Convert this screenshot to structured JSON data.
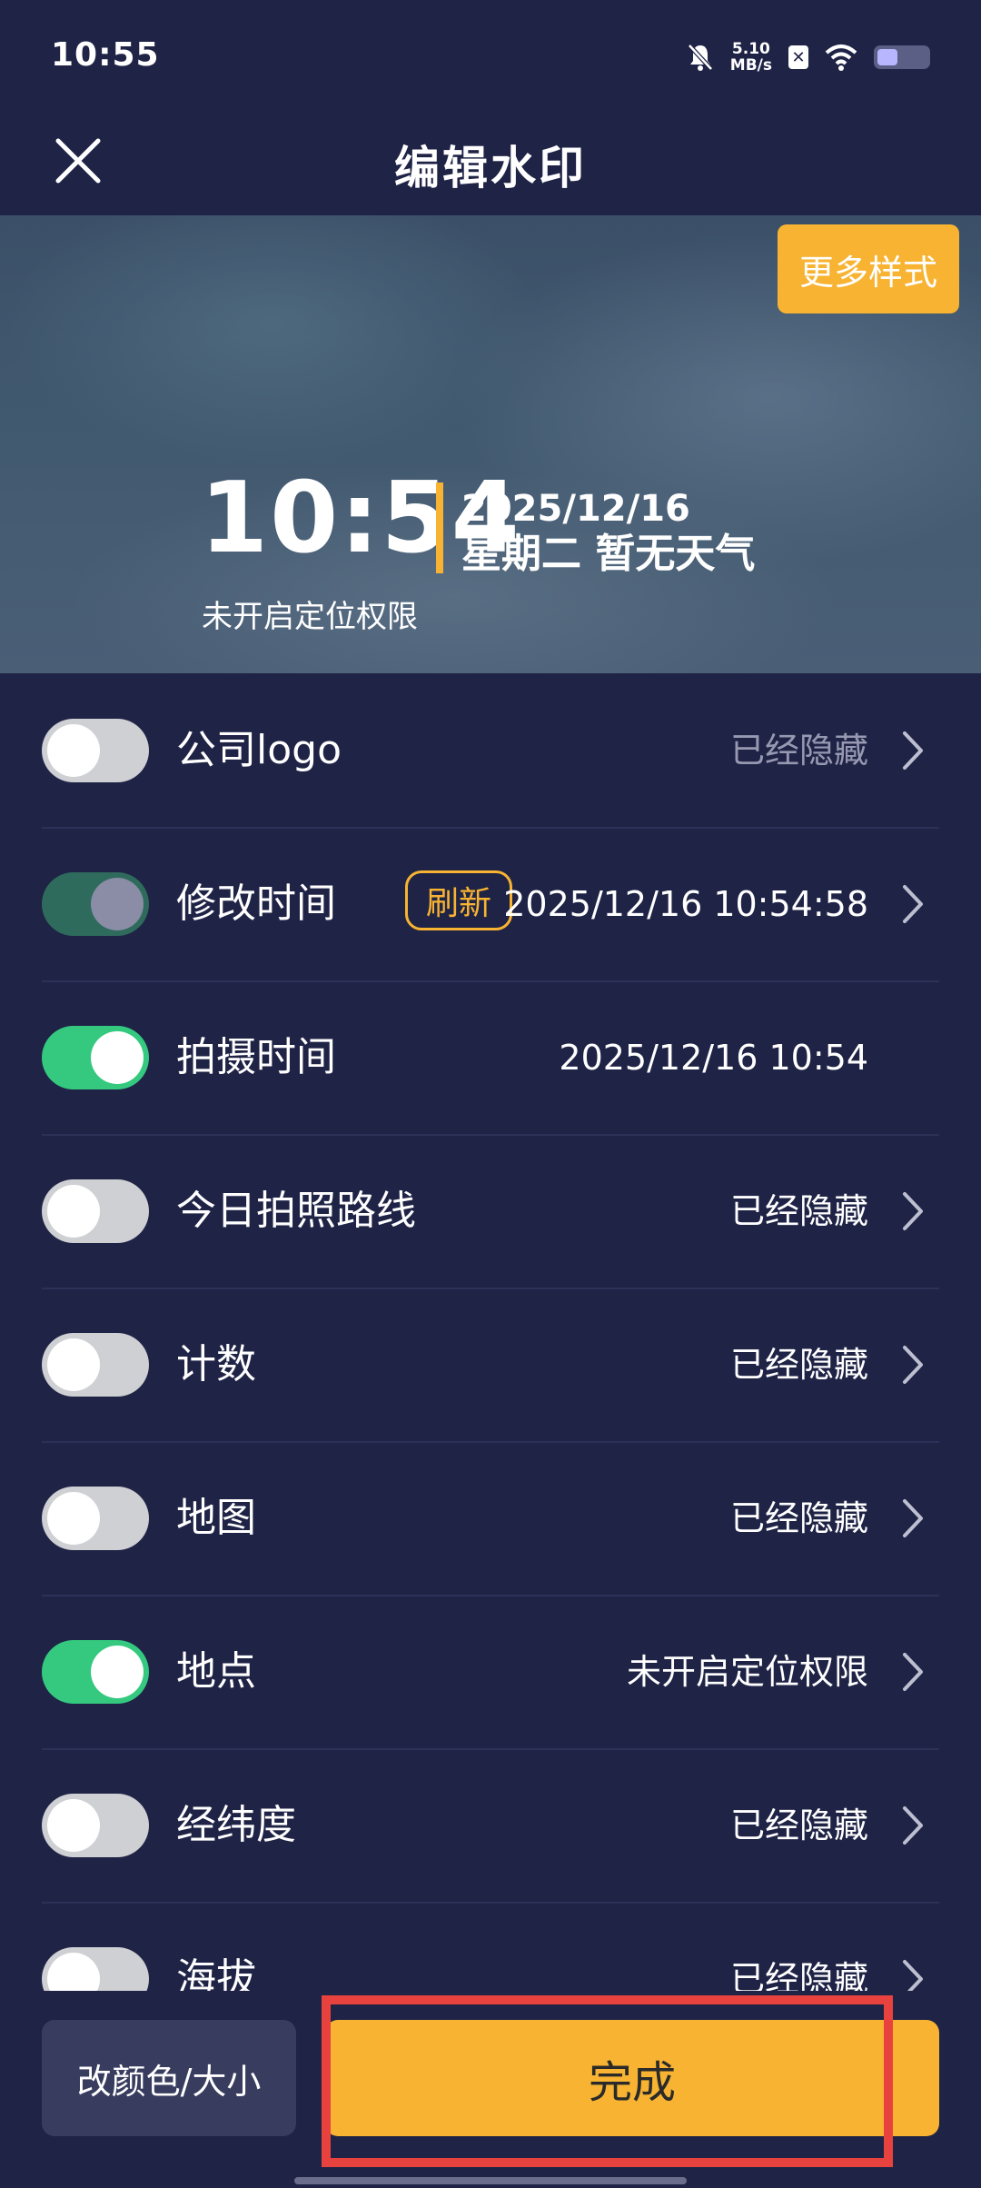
{
  "status_bar": {
    "time": "10:55",
    "net_speed_value": "5.10",
    "net_speed_unit": "MB/s",
    "icons": [
      "bell-muted-icon",
      "nfc-icon",
      "wifi-icon",
      "battery-icon"
    ]
  },
  "header": {
    "title": "编辑水印",
    "close_icon": "close-icon"
  },
  "preview": {
    "more_styles_label": "更多样式",
    "watermark": {
      "time": "10:54",
      "date": "2025/12/16",
      "weekday_weather": "星期二 暂无天气",
      "location": "未开启定位权限"
    },
    "accent_color": "#f7b331"
  },
  "settings": {
    "items": [
      {
        "label": "公司logo",
        "value": "已经隐藏",
        "enabled": false
      },
      {
        "label": "修改时间",
        "refresh_label": "刷新",
        "value": "2025/12/16 10:54:58",
        "enabled": true
      },
      {
        "label": "拍摄时间",
        "value": "2025/12/16 10:54",
        "enabled": true
      },
      {
        "label": "今日拍照路线",
        "value": "已经隐藏",
        "enabled": false
      },
      {
        "label": "计数",
        "value": "已经隐藏",
        "enabled": false
      },
      {
        "label": "地图",
        "value": "已经隐藏",
        "enabled": false
      },
      {
        "label": "地点",
        "value": "未开启定位权限",
        "enabled": true
      },
      {
        "label": "经纬度",
        "value": "已经隐藏",
        "enabled": false
      },
      {
        "label": "海拔",
        "value": "已经隐藏",
        "enabled": false
      }
    ]
  },
  "bottom": {
    "color_size_label": "改颜色/大小",
    "done_label": "完成"
  },
  "colors": {
    "background": "#1f2346",
    "accent": "#f7b331",
    "toggle_on": "#34c97f",
    "highlight": "#e8423e"
  }
}
